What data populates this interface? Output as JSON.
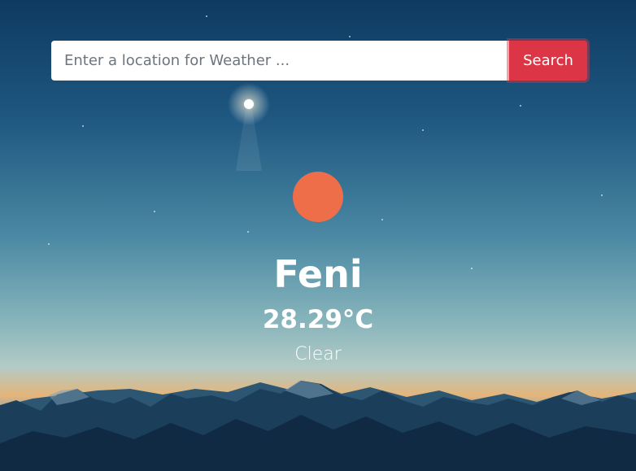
{
  "search": {
    "placeholder": "Enter a location for Weather ...",
    "value": "",
    "button_label": "Search"
  },
  "weather": {
    "icon": "sun-icon",
    "icon_color": "#ee6e4a",
    "city": "Feni",
    "temperature": "28.29°C",
    "condition": "Clear"
  },
  "colors": {
    "accent": "#dc3545",
    "sky_top": "#0f3f66",
    "sky_mid": "#4f8fa6",
    "horizon": "#e0a86a",
    "mountains": "#1a3a56"
  }
}
